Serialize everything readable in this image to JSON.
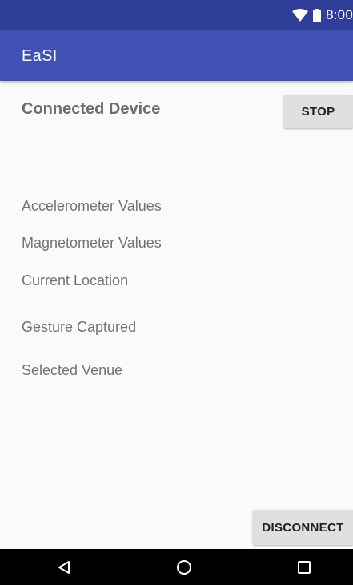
{
  "status_bar": {
    "time": "8:00",
    "icons": [
      "wifi-icon",
      "battery-icon"
    ]
  },
  "app_bar": {
    "title": "EaSI"
  },
  "main": {
    "heading": "Connected Device",
    "stop_label": "STOP",
    "labels": {
      "accelerometer": "Accelerometer Values",
      "magnetometer": "Magnetometer Values",
      "location": "Current Location",
      "gesture": "Gesture Captured",
      "venue": "Selected Venue"
    },
    "disconnect_label": "DISCONNECT"
  },
  "nav_bar": {
    "icons": [
      "back-icon",
      "home-icon",
      "recents-icon"
    ]
  },
  "colors": {
    "status_bar": "#2f3e98",
    "app_bar": "#3f51b5",
    "background": "#fafafa",
    "button": "#e0e0e0",
    "nav_bar": "#000000"
  }
}
